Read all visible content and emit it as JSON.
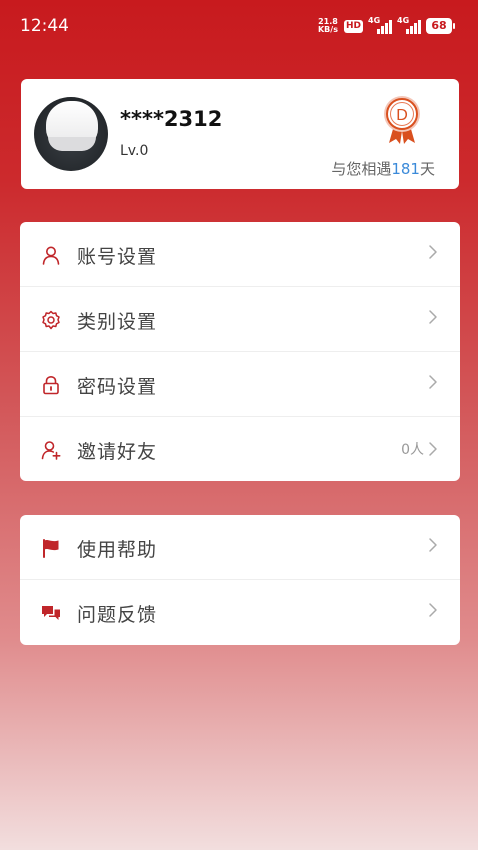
{
  "status_bar": {
    "time": "12:44",
    "net_speed_value": "21.8",
    "net_speed_unit": "KB/s",
    "hd_label": "HD",
    "sim1_label": "4G",
    "sim2_label": "4G",
    "battery": "68"
  },
  "profile": {
    "username": "****2312",
    "level": "Lv.0",
    "met_prefix": "与您相遇",
    "met_days": "181",
    "met_suffix": "天",
    "medal_letter": "D"
  },
  "menu_main": [
    {
      "label": "账号设置",
      "icon": "user-icon"
    },
    {
      "label": "类别设置",
      "icon": "gear-icon"
    },
    {
      "label": "密码设置",
      "icon": "lock-icon"
    },
    {
      "label": "邀请好友",
      "icon": "add-user-icon",
      "value": "0人"
    }
  ],
  "menu_help": [
    {
      "label": "使用帮助",
      "icon": "flag-icon"
    },
    {
      "label": "问题反馈",
      "icon": "chat-bubbles-icon"
    }
  ],
  "colors": {
    "brand_red": "#c81a1e",
    "accent_blue": "#3b8ad9"
  }
}
